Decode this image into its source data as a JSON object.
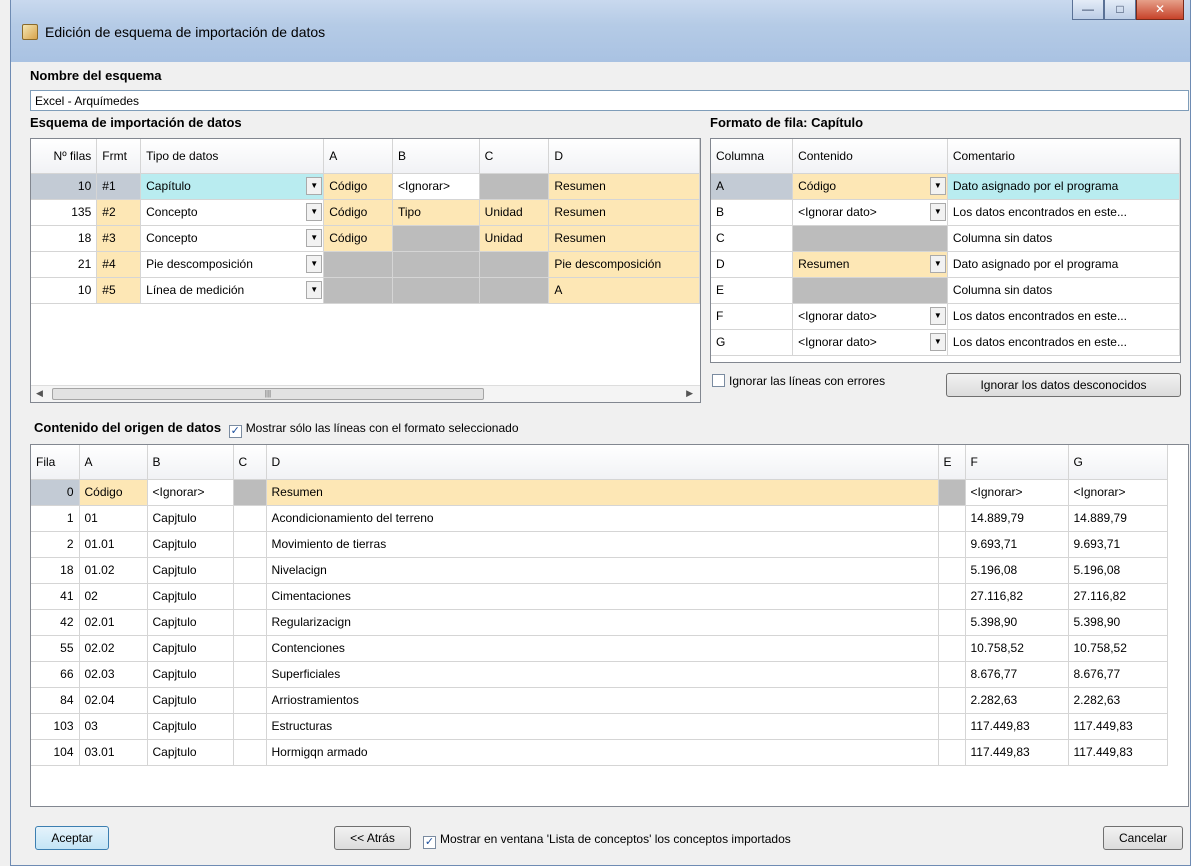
{
  "window": {
    "title": "Edición de esquema de importación de datos"
  },
  "schema_name": {
    "label": "Nombre del esquema",
    "value": "Excel - Arquímedes"
  },
  "import_schema": {
    "label": "Esquema de importación de datos",
    "headers": [
      "Nº filas",
      "Frmt",
      "Tipo de datos",
      "A",
      "B",
      "C",
      "D"
    ],
    "rows": [
      {
        "count": "10",
        "fmt": "#1",
        "type": "Capítulo",
        "a": "Código",
        "b": "<Ignorar>",
        "c": "",
        "d": "Resumen"
      },
      {
        "count": "135",
        "fmt": "#2",
        "type": "Concepto",
        "a": "Código",
        "b": "Tipo",
        "c": "Unidad",
        "d": "Resumen"
      },
      {
        "count": "18",
        "fmt": "#3",
        "type": "Concepto",
        "a": "Código",
        "b": "",
        "c": "Unidad",
        "d": "Resumen"
      },
      {
        "count": "21",
        "fmt": "#4",
        "type": "Pie descomposición",
        "a": "",
        "b": "",
        "c": "",
        "d": "Pie descomposición"
      },
      {
        "count": "10",
        "fmt": "#5",
        "type": "Línea de medición",
        "a": "",
        "b": "",
        "c": "",
        "d": "A"
      }
    ]
  },
  "row_format": {
    "label": "Formato de fila: Capítulo",
    "headers": [
      "Columna",
      "Contenido",
      "Comentario"
    ],
    "rows": [
      {
        "col": "A",
        "content": "Código",
        "comment": "Dato asignado por el programa"
      },
      {
        "col": "B",
        "content": "<Ignorar dato>",
        "comment": "Los datos encontrados en este..."
      },
      {
        "col": "C",
        "content": "",
        "comment": "Columna sin datos"
      },
      {
        "col": "D",
        "content": "Resumen",
        "comment": "Dato asignado por el programa"
      },
      {
        "col": "E",
        "content": "",
        "comment": "Columna sin datos"
      },
      {
        "col": "F",
        "content": "<Ignorar dato>",
        "comment": "Los datos encontrados en este..."
      },
      {
        "col": "G",
        "content": "<Ignorar dato>",
        "comment": "Los datos encontrados en este..."
      }
    ],
    "ignore_errors_label": "Ignorar las líneas con errores",
    "ignore_unknown_button": "Ignorar los datos desconocidos"
  },
  "source": {
    "label": "Contenido del origen de datos",
    "show_only_label": "Mostrar sólo las líneas con el formato seleccionado",
    "headers": [
      "Fila",
      "A",
      "B",
      "C",
      "D",
      "E",
      "F",
      "G"
    ],
    "rows": [
      {
        "fila": "0",
        "a": "Código",
        "b": "<Ignorar>",
        "c": "",
        "d": "Resumen",
        "e": "",
        "f": "<Ignorar>",
        "g": "<Ignorar>"
      },
      {
        "fila": "1",
        "a": "01",
        "b": "Capjtulo",
        "c": "",
        "d": "Acondicionamiento del terreno",
        "e": "",
        "f": "14.889,79",
        "g": "14.889,79"
      },
      {
        "fila": "2",
        "a": "01.01",
        "b": "Capjtulo",
        "c": "",
        "d": "Movimiento de tierras",
        "e": "",
        "f": "9.693,71",
        "g": "9.693,71"
      },
      {
        "fila": "18",
        "a": "01.02",
        "b": "Capjtulo",
        "c": "",
        "d": "Nivelacign",
        "e": "",
        "f": "5.196,08",
        "g": "5.196,08"
      },
      {
        "fila": "41",
        "a": "02",
        "b": "Capjtulo",
        "c": "",
        "d": "Cimentaciones",
        "e": "",
        "f": "27.116,82",
        "g": "27.116,82"
      },
      {
        "fila": "42",
        "a": "02.01",
        "b": "Capjtulo",
        "c": "",
        "d": "Regularizacign",
        "e": "",
        "f": "5.398,90",
        "g": "5.398,90"
      },
      {
        "fila": "55",
        "a": "02.02",
        "b": "Capjtulo",
        "c": "",
        "d": "Contenciones",
        "e": "",
        "f": "10.758,52",
        "g": "10.758,52"
      },
      {
        "fila": "66",
        "a": "02.03",
        "b": "Capjtulo",
        "c": "",
        "d": "Superficiales",
        "e": "",
        "f": "8.676,77",
        "g": "8.676,77"
      },
      {
        "fila": "84",
        "a": "02.04",
        "b": "Capjtulo",
        "c": "",
        "d": "Arriostramientos",
        "e": "",
        "f": "2.282,63",
        "g": "2.282,63"
      },
      {
        "fila": "103",
        "a": "03",
        "b": "Capjtulo",
        "c": "",
        "d": "Estructuras",
        "e": "",
        "f": "117.449,83",
        "g": "117.449,83"
      },
      {
        "fila": "104",
        "a": "03.01",
        "b": "Capjtulo",
        "c": "",
        "d": "Hormigqn armado",
        "e": "",
        "f": "117.449,83",
        "g": "117.449,83"
      }
    ]
  },
  "footer": {
    "accept": "Aceptar",
    "back": "<< Atrás",
    "show_concepts_label": "Mostrar en ventana 'Lista de conceptos' los conceptos importados",
    "cancel": "Cancelar"
  },
  "colors": {
    "highlight_cyan": "#b9ecf0",
    "highlight_yellow": "#fde7b5",
    "disabled_gray": "#bcbcbc"
  }
}
